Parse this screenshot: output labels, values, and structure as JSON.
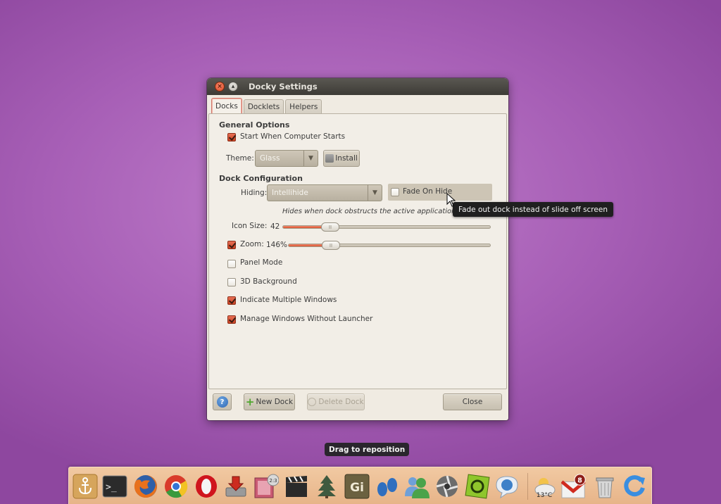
{
  "window": {
    "title": "Docky Settings",
    "close_glyph": "×",
    "max_glyph": "▴"
  },
  "tabs": [
    {
      "label": "Docks",
      "active": true
    },
    {
      "label": "Docklets",
      "active": false
    },
    {
      "label": "Helpers",
      "active": false
    }
  ],
  "general": {
    "heading": "General Options",
    "start_label": "Start When Computer Starts",
    "start_checked": true,
    "theme_label": "Theme:",
    "theme_value": "Glass",
    "install_label": "Install"
  },
  "dock_config": {
    "heading": "Dock Configuration",
    "hiding_label": "Hiding:",
    "hiding_value": "Intellihide",
    "fade_label": "Fade On Hide",
    "fade_checked": false,
    "hiding_description": "Hides when dock obstructs the active application.",
    "icon_size_label": "Icon Size:",
    "icon_size_value": "42",
    "icon_size_fraction": 0.2,
    "zoom_label": "Zoom:",
    "zoom_checked": true,
    "zoom_value": "146%",
    "zoom_fraction": 0.18,
    "panel_mode_label": "Panel Mode",
    "panel_mode_checked": false,
    "bg3d_label": "3D Background",
    "bg3d_checked": false,
    "indicate_label": "Indicate Multiple Windows",
    "indicate_checked": true,
    "manage_label": "Manage Windows Without Launcher",
    "manage_checked": true
  },
  "footer": {
    "help_glyph": "?",
    "new_dock_label": "New Dock",
    "delete_dock_label": "Delete Dock",
    "close_label": "Close"
  },
  "tooltip": "Fade out dock instead of slide off screen",
  "drag_tip": "Drag to reposition",
  "dock": {
    "gimp_label": "Gi",
    "weather_temp": "13°C",
    "gmail_badge": "8",
    "calendar_badge": "2:3",
    "terminal_prompt": ">_"
  },
  "colors": {
    "accent": "#d9522e",
    "wallpaper": "#a75fb6",
    "titlebar": "#3d3b36"
  }
}
